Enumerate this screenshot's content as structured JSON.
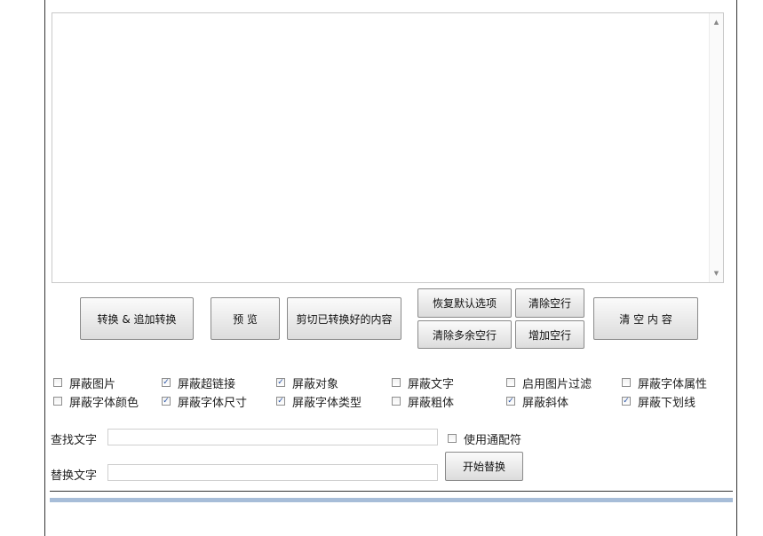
{
  "buttons": {
    "convert": "转换 & 追加转换",
    "preview": "预 览",
    "cut_converted": "剪切已转换好的内容",
    "restore_defaults": "恢复默认选项",
    "clear_empty_lines": "清除空行",
    "clear_extra_lines": "清除多余空行",
    "add_empty_lines": "增加空行",
    "clear_content": "清 空 内 容",
    "start_replace": "开始替换"
  },
  "options": {
    "row1": [
      {
        "label": "屏蔽图片",
        "checked": false
      },
      {
        "label": "屏蔽超链接",
        "checked": true
      },
      {
        "label": "屏蔽对象",
        "checked": true
      },
      {
        "label": "屏蔽文字",
        "checked": false
      },
      {
        "label": "启用图片过滤",
        "checked": false
      },
      {
        "label": "屏蔽字体属性",
        "checked": false
      }
    ],
    "row2": [
      {
        "label": "屏蔽字体颜色",
        "checked": false
      },
      {
        "label": "屏蔽字体尺寸",
        "checked": true
      },
      {
        "label": "屏蔽字体类型",
        "checked": true
      },
      {
        "label": "屏蔽粗体",
        "checked": false
      },
      {
        "label": "屏蔽斜体",
        "checked": true
      },
      {
        "label": "屏蔽下划线",
        "checked": true
      }
    ]
  },
  "find": {
    "label": "查找文字",
    "value": ""
  },
  "replace": {
    "label": "替换文字",
    "value": ""
  },
  "wildcard": {
    "label": "使用通配符",
    "checked": false
  },
  "scroll": {
    "up_icon": "▲",
    "down_icon": "▼"
  },
  "colors": {
    "accent_bar": "#a7bdd8",
    "check": "#2a55a8"
  }
}
